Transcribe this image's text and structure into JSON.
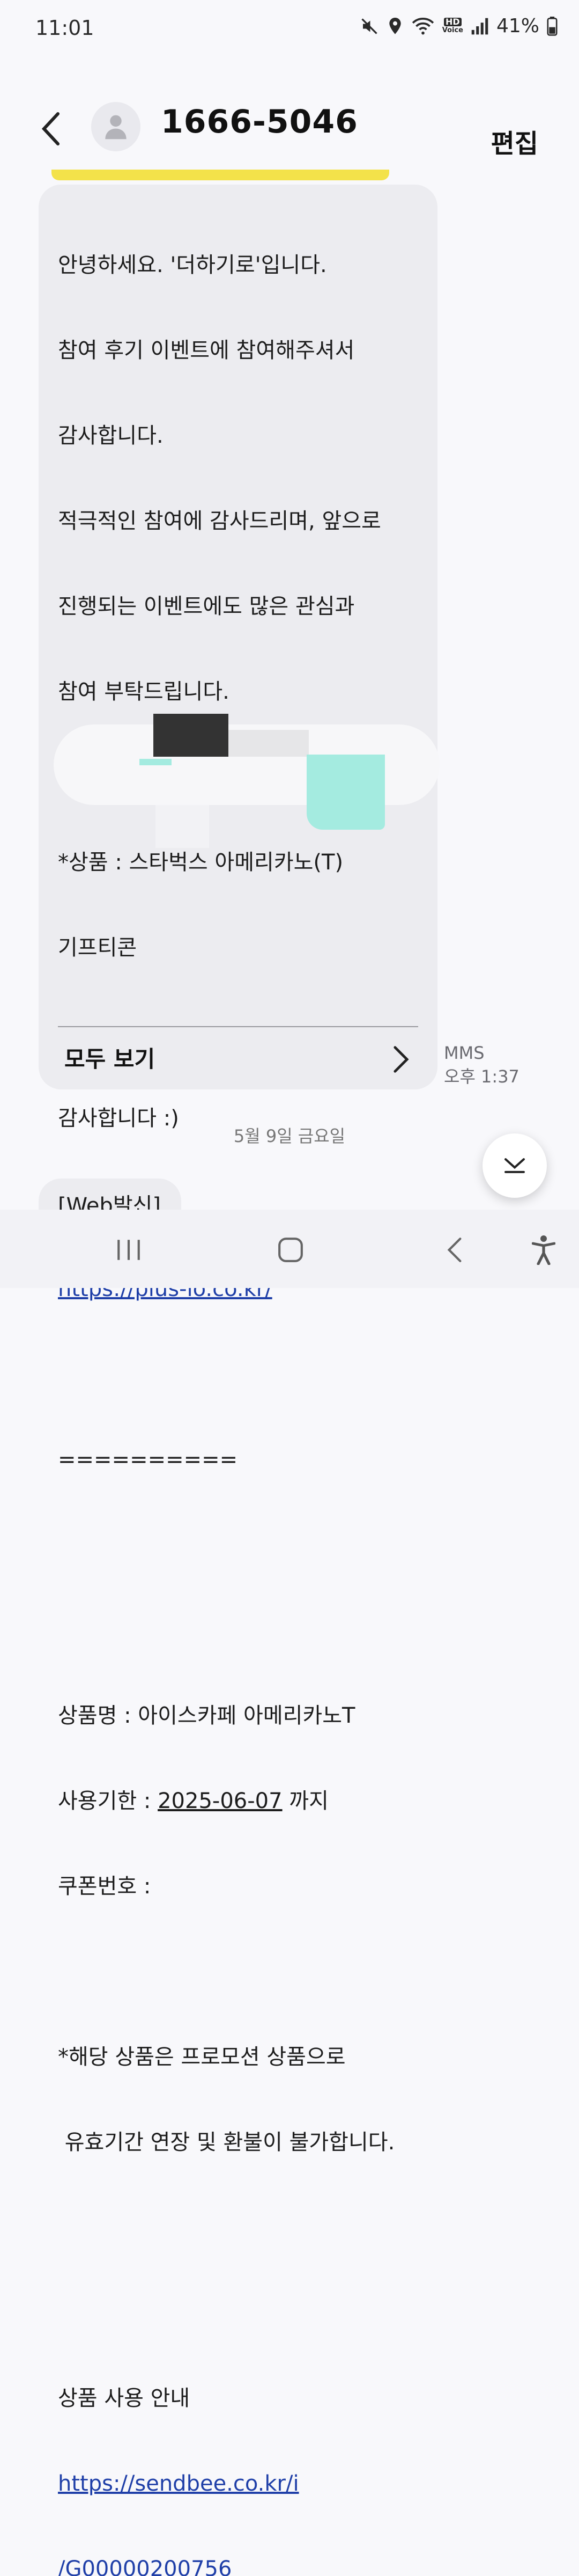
{
  "status_bar": {
    "time": "11:01",
    "battery": "41%",
    "icons": [
      "mute-icon",
      "location-icon",
      "wifi-icon",
      "hd-voice-icon",
      "signal-icon",
      "battery-icon"
    ],
    "hd_label": "HD",
    "voice_label": "Voice"
  },
  "header": {
    "title": "1666-5046",
    "edit_label": "편집"
  },
  "message": {
    "lines": {
      "l1": "안녕하세요. '더하기로'입니다.",
      "l2": "참여 후기 이벤트에 참여해주셔서",
      "l3": "감사합니다.",
      "l4": "적극적인 참여에 감사드리며, 앞으로",
      "l5": "진행되는 이벤트에도 많은 관심과",
      "l6": "참여 부탁드립니다.",
      "l7": "*상품 : 스타벅스 아메리카노(T)",
      "l8": "기프티콘",
      "l9": "감사합니다 :)",
      "link1": "https://plus-lo.co.kr/",
      "separator": "==========",
      "l10": "상품명 : 아이스카페 아메리카노T",
      "l11a": "사용기한 : ",
      "l11date": "2025-06-07",
      "l11b": " 까지",
      "l12": "쿠폰번호 : ",
      "l13": "*해당 상품은 프로모션 상품으로",
      "l14": " 유효기간 연장 및 환불이 불가합니다.",
      "l15": "상품 사용 안내",
      "link2a": "https://sendbee.co.kr/i",
      "link2b": "/G00000200756"
    },
    "see_all_label": "모두 보기",
    "type": "MMS",
    "time": "오후 1:37"
  },
  "date_separator": "5월 9일 금요일",
  "next_message_preview": "[Web발신]",
  "colors": {
    "accent_yellow": "#f3e24a",
    "link": "#1f3fa8",
    "bubble": "#ececf0",
    "redact_dark": "#333333",
    "redact_cyan": "#a4ebe0"
  }
}
